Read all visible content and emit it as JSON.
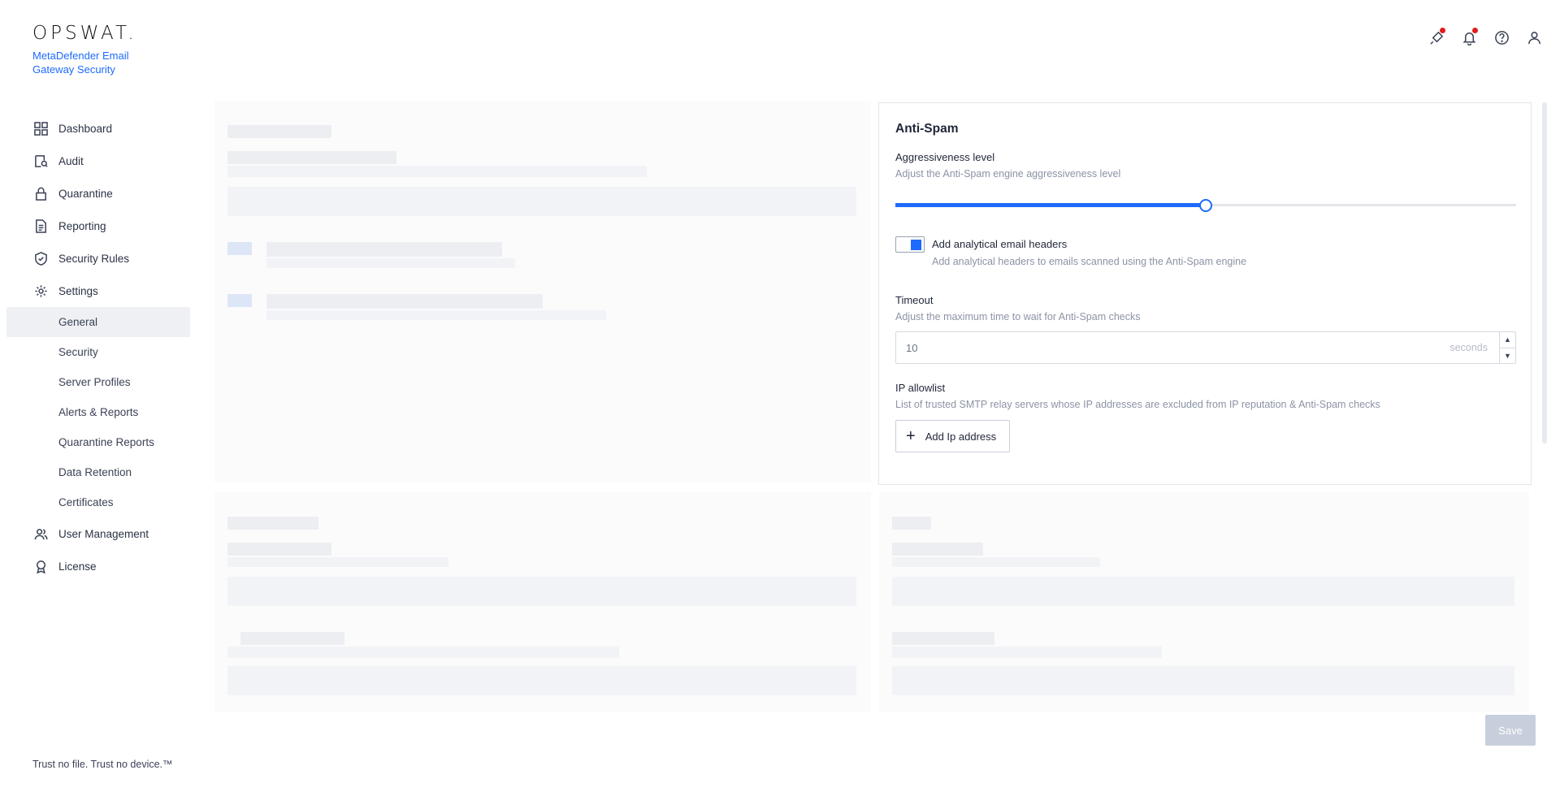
{
  "brand": {
    "logo_text": "OPSWAT.",
    "product_name": "MetaDefender Email Gateway Security",
    "tagline": "Trust no file. Trust no device.™"
  },
  "topbar": {
    "icons": [
      "plug-icon",
      "bell-icon",
      "help-icon",
      "user-icon"
    ]
  },
  "sidebar": {
    "items": [
      {
        "label": "Dashboard",
        "icon": "dashboard-grid-icon"
      },
      {
        "label": "Audit",
        "icon": "audit-icon"
      },
      {
        "label": "Quarantine",
        "icon": "lock-icon"
      },
      {
        "label": "Reporting",
        "icon": "document-icon"
      },
      {
        "label": "Security Rules",
        "icon": "shield-check-icon"
      },
      {
        "label": "Settings",
        "icon": "gear-icon"
      }
    ],
    "settings_children": [
      {
        "label": "General",
        "active": true
      },
      {
        "label": "Security"
      },
      {
        "label": "Server Profiles"
      },
      {
        "label": "Alerts & Reports"
      },
      {
        "label": "Quarantine Reports"
      },
      {
        "label": "Data Retention"
      },
      {
        "label": "Certificates"
      }
    ],
    "bottom_items": [
      {
        "label": "User Management",
        "icon": "users-icon"
      },
      {
        "label": "License",
        "icon": "badge-icon"
      }
    ]
  },
  "antispam": {
    "title": "Anti-Spam",
    "aggressiveness": {
      "label": "Aggressiveness level",
      "help": "Adjust the Anti-Spam engine aggressiveness level",
      "value_fraction": 0.5
    },
    "headers": {
      "label": "Add analytical email headers",
      "help": "Add analytical headers to emails scanned using the Anti-Spam engine",
      "enabled": true
    },
    "timeout": {
      "label": "Timeout",
      "help": "Adjust the maximum time to wait for Anti-Spam checks",
      "value": "10",
      "unit": "seconds"
    },
    "allowlist": {
      "label": "IP allowlist",
      "help": "List of trusted SMTP relay servers whose IP addresses are excluded from IP reputation & Anti-Spam checks",
      "add_button": "Add Ip address"
    }
  },
  "footer": {
    "save_label": "Save"
  },
  "colors": {
    "accent": "#1d6bfc",
    "alert_dot": "#e21b1b"
  }
}
